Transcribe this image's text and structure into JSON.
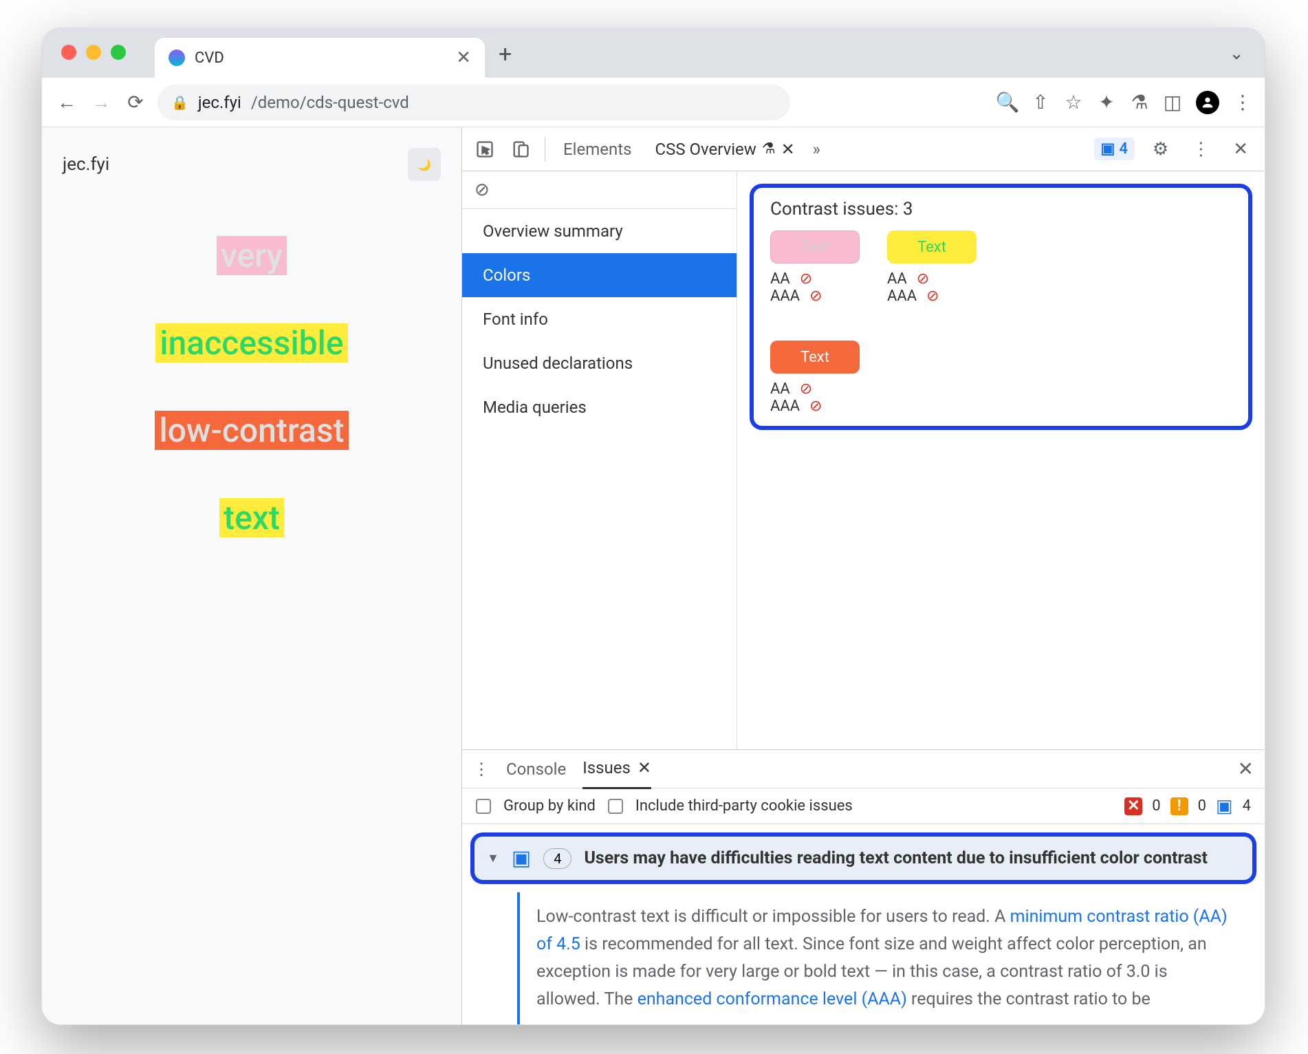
{
  "browser": {
    "tab_title": "CVD",
    "url_host": "jec.fyi",
    "url_path": "/demo/cds-quest-cvd"
  },
  "page": {
    "site_name": "jec.fyi",
    "words": [
      "very",
      "inaccessible",
      "low-contrast",
      "text"
    ]
  },
  "devtools": {
    "tabs": {
      "elements": "Elements",
      "css_overview": "CSS Overview"
    },
    "issues_badge_count": "4",
    "sidebar": {
      "items": [
        "Overview summary",
        "Colors",
        "Font info",
        "Unused declarations",
        "Media queries"
      ],
      "active_index": 1
    },
    "contrast": {
      "title": "Contrast issues: 3",
      "swatch_label": "Text",
      "aa": "AA",
      "aaa": "AAA"
    }
  },
  "drawer": {
    "tabs": {
      "console": "Console",
      "issues": "Issues"
    },
    "group_by_kind": "Group by kind",
    "third_party": "Include third-party cookie issues",
    "counts": {
      "errors": "0",
      "warnings": "0",
      "info": "4"
    },
    "issue": {
      "count": "4",
      "title": "Users may have difficulties reading text content due to insufficient color contrast",
      "body_pre": "Low-contrast text is difficult or impossible for users to read. A ",
      "link1": "minimum contrast ratio (AA) of 4.5",
      "body_mid": " is recommended for all text. Since font size and weight affect color perception, an exception is made for very large or bold text — in this case, a contrast ratio of 3.0 is allowed. The ",
      "link2": "enhanced conformance level (AAA)",
      "body_post": " requires the contrast ratio to be"
    }
  }
}
